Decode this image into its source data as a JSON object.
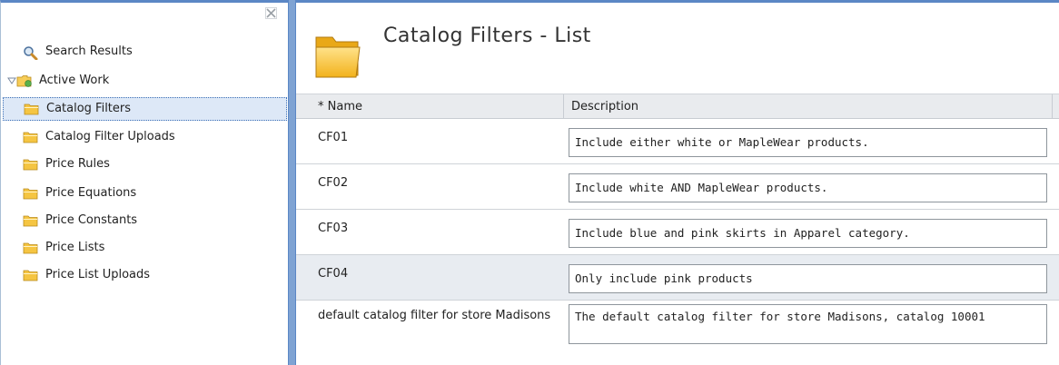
{
  "nav": {
    "items": [
      {
        "label": "Search Results",
        "icon": "search-icon"
      },
      {
        "label": "Active Work",
        "icon": "active-work-folder-icon"
      },
      {
        "label": "Catalog Filters",
        "icon": "folder-icon",
        "selected": true
      },
      {
        "label": "Catalog Filter Uploads",
        "icon": "folder-icon"
      },
      {
        "label": "Price Rules",
        "icon": "folder-icon"
      },
      {
        "label": "Price Equations",
        "icon": "folder-icon"
      },
      {
        "label": "Price Constants",
        "icon": "folder-icon"
      },
      {
        "label": "Price Lists",
        "icon": "folder-icon"
      },
      {
        "label": "Price List Uploads",
        "icon": "folder-icon"
      }
    ],
    "close_icon": "close-icon"
  },
  "main": {
    "title": "Catalog Filters - List",
    "table": {
      "headers": {
        "name": "* Name",
        "description": "Description"
      },
      "rows": [
        {
          "name": "CF01",
          "description": "Include either white or MapleWear products."
        },
        {
          "name": "CF02",
          "description": "Include white AND MapleWear products."
        },
        {
          "name": "CF03",
          "description": "Include blue and pink skirts in Apparel category."
        },
        {
          "name": "CF04",
          "description": "Only include pink products"
        },
        {
          "name": "default catalog filter for store Madisons",
          "description": "The default catalog filter for store Madisons, catalog 10001"
        }
      ]
    }
  },
  "colors": {
    "accent": "#5b87c5",
    "selected_bg": "#dde8f7",
    "header_bg": "#e9ebee",
    "alt_row_bg": "#e8ecf1",
    "folder_yellow": "#f5c542"
  }
}
